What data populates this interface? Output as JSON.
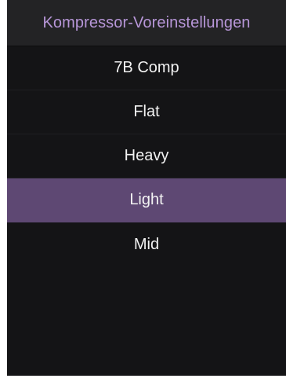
{
  "header": {
    "title": "Kompressor-Voreinstellungen"
  },
  "presets": [
    {
      "label": "7B Comp",
      "selected": false
    },
    {
      "label": "Flat",
      "selected": false
    },
    {
      "label": "Heavy",
      "selected": false
    },
    {
      "label": "Light",
      "selected": true
    },
    {
      "label": "Mid",
      "selected": false
    }
  ],
  "colors": {
    "accent": "#b796d8",
    "selected_background": "#5e4873",
    "panel_background": "#141416",
    "header_background": "#232325"
  }
}
